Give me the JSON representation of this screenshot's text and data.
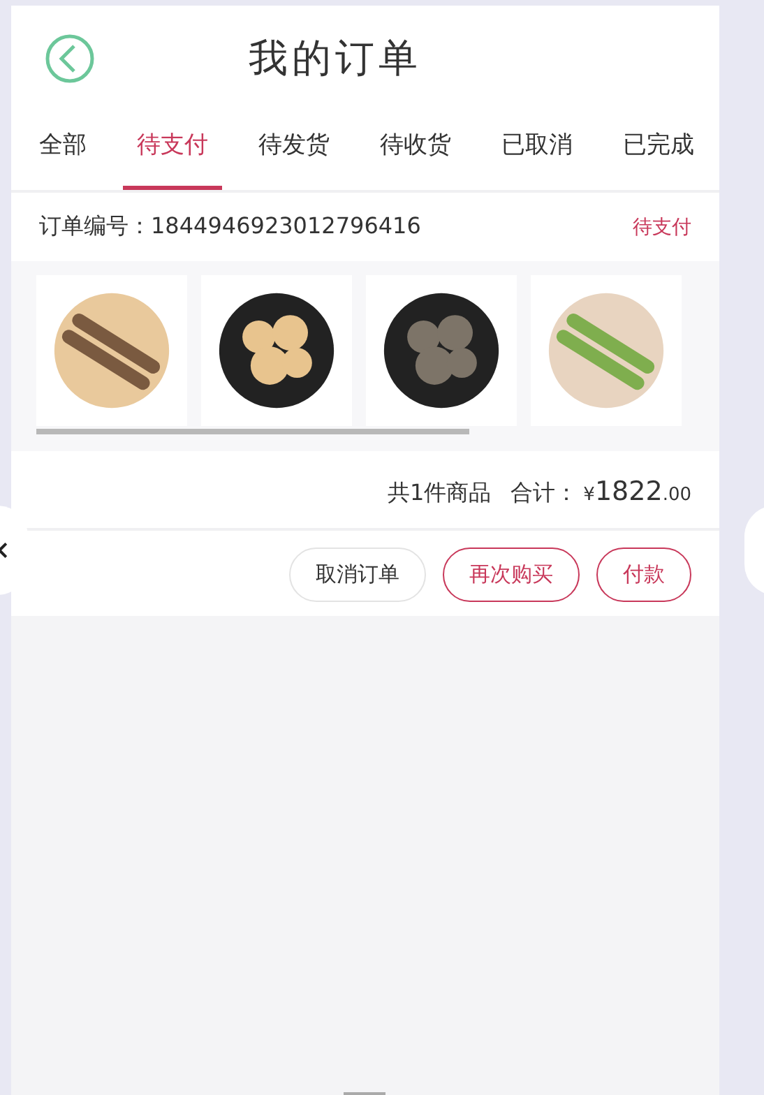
{
  "header": {
    "title": "我的订单"
  },
  "tabs": [
    {
      "label": "全部",
      "selected": false
    },
    {
      "label": "待支付",
      "selected": true
    },
    {
      "label": "待发货",
      "selected": false
    },
    {
      "label": "待收货",
      "selected": false
    },
    {
      "label": "已取消",
      "selected": false
    },
    {
      "label": "已完成",
      "selected": false
    }
  ],
  "order": {
    "number_label": "订单编号：",
    "number": "1844946923012796416",
    "status": "待支付",
    "products": [
      {
        "kind": "roots"
      },
      {
        "kind": "shellfish"
      },
      {
        "kind": "shrimp"
      },
      {
        "kind": "gourd"
      }
    ],
    "count": "共1件商品",
    "total_label": "合计：",
    "currency": "¥",
    "amount": "1822",
    "cents": ".00",
    "buttons": [
      {
        "label": "取消订单",
        "kind": "plain"
      },
      {
        "label": "再次购买",
        "kind": "accent"
      },
      {
        "label": "付款",
        "kind": "accent"
      }
    ]
  }
}
